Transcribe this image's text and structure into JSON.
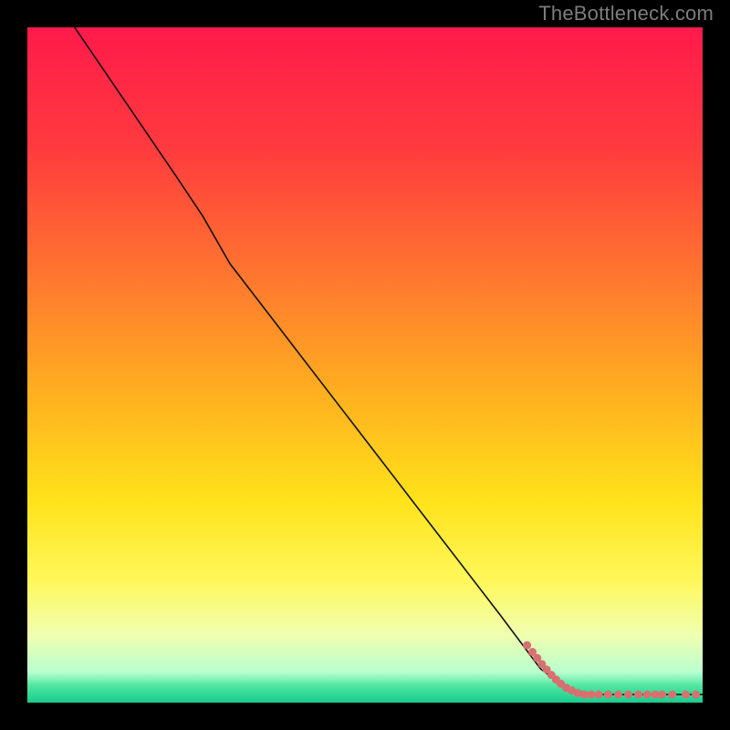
{
  "watermark": "TheBottleneck.com",
  "chart_data": {
    "type": "line",
    "title": "",
    "xlabel": "",
    "ylabel": "",
    "xlim": [
      0,
      100
    ],
    "ylim": [
      0,
      100
    ],
    "grid": false,
    "legend": false,
    "background_gradient": {
      "stops": [
        {
          "pos": 0.0,
          "color": "#ff1a4b"
        },
        {
          "pos": 0.18,
          "color": "#ff3b3e"
        },
        {
          "pos": 0.38,
          "color": "#ff7a2e"
        },
        {
          "pos": 0.55,
          "color": "#ffb21f"
        },
        {
          "pos": 0.7,
          "color": "#ffe21a"
        },
        {
          "pos": 0.82,
          "color": "#fff85c"
        },
        {
          "pos": 0.9,
          "color": "#f0ffb0"
        },
        {
          "pos": 0.955,
          "color": "#b8ffcf"
        },
        {
          "pos": 0.975,
          "color": "#4fe6a0"
        },
        {
          "pos": 1.0,
          "color": "#18cc8f"
        }
      ]
    },
    "series": [
      {
        "name": "bottleneck-curve",
        "color": "#111111",
        "stroke_width": 1.6,
        "points": [
          {
            "x": 7,
            "y": 100
          },
          {
            "x": 22,
            "y": 78
          },
          {
            "x": 26,
            "y": 72
          },
          {
            "x": 30,
            "y": 65
          },
          {
            "x": 40,
            "y": 52
          },
          {
            "x": 50,
            "y": 39
          },
          {
            "x": 60,
            "y": 26
          },
          {
            "x": 70,
            "y": 13
          },
          {
            "x": 76,
            "y": 5
          },
          {
            "x": 80,
            "y": 2
          },
          {
            "x": 84,
            "y": 1.2
          },
          {
            "x": 100,
            "y": 1.2
          }
        ]
      }
    ],
    "scatter": {
      "name": "data-dots",
      "color": "#d87070",
      "radius": 4.5,
      "points": [
        {
          "x": 74.0,
          "y": 8.5
        },
        {
          "x": 74.8,
          "y": 7.5
        },
        {
          "x": 75.5,
          "y": 6.6
        },
        {
          "x": 76.2,
          "y": 5.7
        },
        {
          "x": 76.9,
          "y": 4.9
        },
        {
          "x": 77.6,
          "y": 4.1
        },
        {
          "x": 78.3,
          "y": 3.4
        },
        {
          "x": 79.0,
          "y": 2.8
        },
        {
          "x": 79.8,
          "y": 2.2
        },
        {
          "x": 80.6,
          "y": 1.8
        },
        {
          "x": 81.5,
          "y": 1.4
        },
        {
          "x": 82.5,
          "y": 1.2
        },
        {
          "x": 83.5,
          "y": 1.2
        },
        {
          "x": 84.6,
          "y": 1.2
        },
        {
          "x": 86.0,
          "y": 1.2
        },
        {
          "x": 87.5,
          "y": 1.2
        },
        {
          "x": 89.0,
          "y": 1.2
        },
        {
          "x": 90.5,
          "y": 1.2
        },
        {
          "x": 91.8,
          "y": 1.2
        },
        {
          "x": 93.0,
          "y": 1.2
        },
        {
          "x": 94.0,
          "y": 1.2
        },
        {
          "x": 95.5,
          "y": 1.2
        },
        {
          "x": 97.5,
          "y": 1.2
        },
        {
          "x": 99.0,
          "y": 1.2
        }
      ]
    }
  }
}
